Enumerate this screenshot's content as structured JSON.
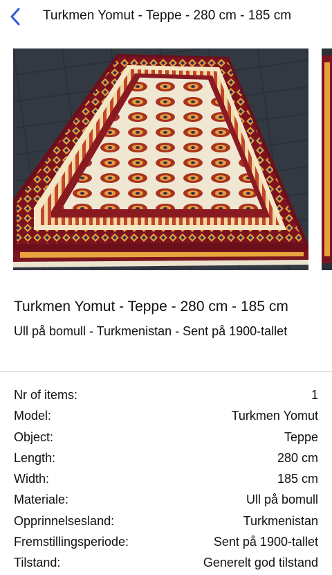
{
  "nav": {
    "back_icon": "chevron-left-icon",
    "title": "Turkmen Yomut - Teppe - 280 cm - 185 cm",
    "accent_color": "#2f5bd8"
  },
  "gallery": {
    "images": [
      {
        "name": "rug-photo-1",
        "colors": {
          "border": "#7a1620",
          "field": "#f0ead8",
          "gul": "#b83a2a",
          "floor": "#2a2f36"
        }
      },
      {
        "name": "rug-photo-2"
      }
    ]
  },
  "details": {
    "title": "Turkmen Yomut - Teppe - 280 cm - 185 cm",
    "subtitle": "Ull på bomull - Turkmenistan - Sent på 1900-tallet"
  },
  "specs": [
    {
      "label": "Nr of items:",
      "value": "1"
    },
    {
      "label": "Model:",
      "value": "Turkmen Yomut"
    },
    {
      "label": "Object:",
      "value": "Teppe"
    },
    {
      "label": "Length:",
      "value": "280 cm"
    },
    {
      "label": "Width:",
      "value": "185 cm"
    },
    {
      "label": "Materiale:",
      "value": "Ull på bomull"
    },
    {
      "label": "Opprinnelsesland:",
      "value": "Turkmenistan"
    },
    {
      "label": "Fremstillingsperiode:",
      "value": "Sent på 1900-tallet"
    },
    {
      "label": "Tilstand:",
      "value": "Generelt god tilstand"
    }
  ]
}
